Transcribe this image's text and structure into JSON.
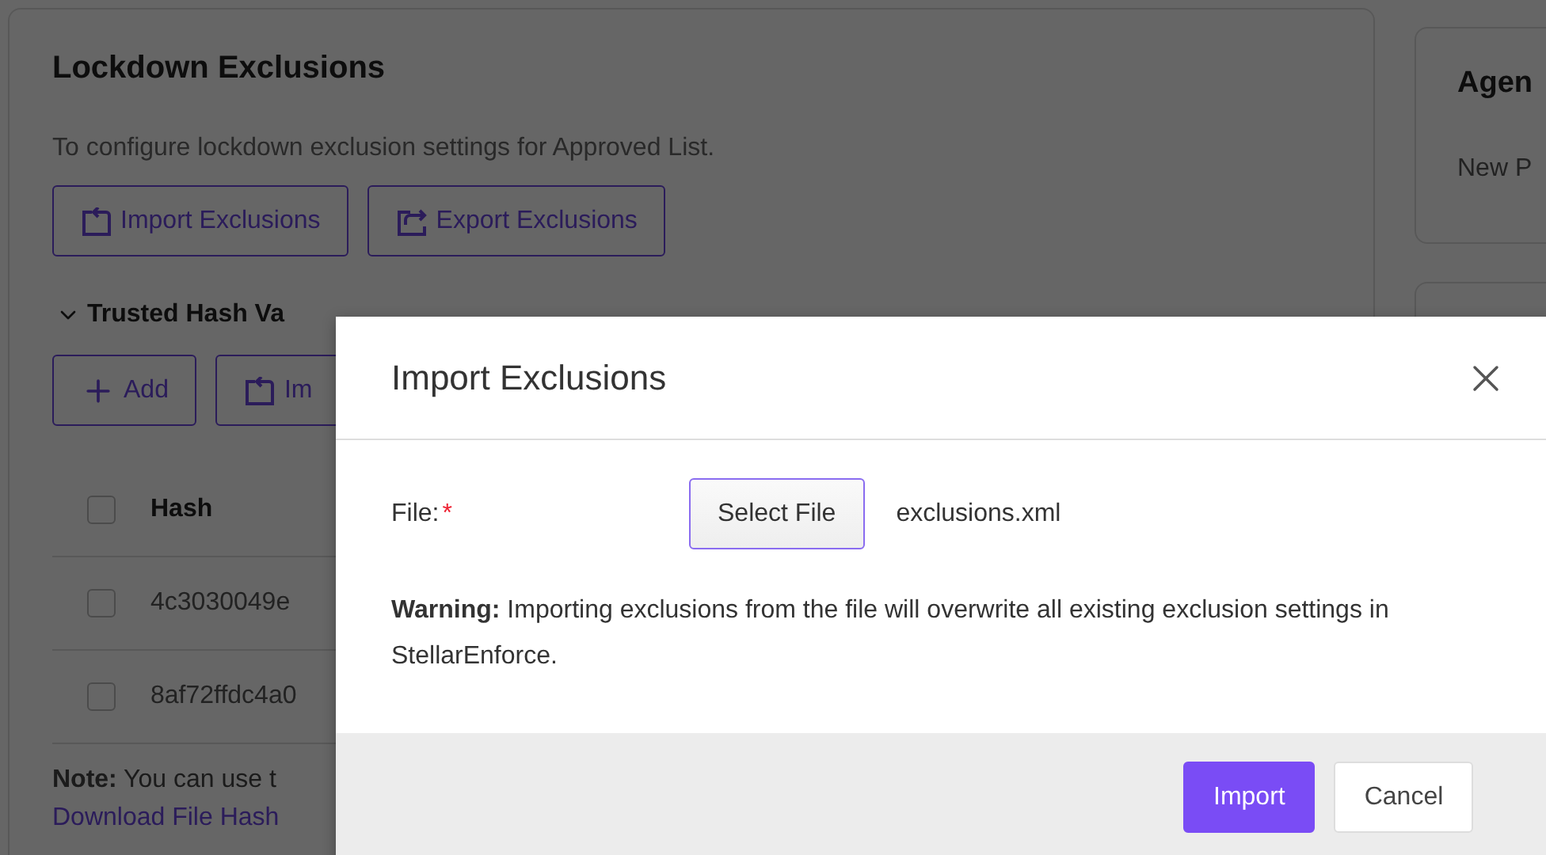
{
  "page": {
    "title": "Lockdown Exclusions",
    "description": "To configure lockdown exclusion settings for Approved List.",
    "buttons": [
      {
        "label": "Import Exclusions",
        "kind": "import"
      },
      {
        "label": "Export Exclusions",
        "kind": "export"
      }
    ],
    "section": {
      "title": "Trusted Hash Va",
      "expanded": true,
      "buttons": [
        {
          "label": "Add",
          "kind": "add"
        },
        {
          "label": "Im",
          "kind": "import"
        }
      ],
      "table": {
        "columns": [
          "Hash"
        ],
        "header_checked": false,
        "rows": [
          {
            "hash": "4c3030049e",
            "checked": false
          },
          {
            "hash": "8af72ffdc4a0",
            "checked": false
          }
        ]
      },
      "note": "**Note:** You can use t",
      "link": "Download File Hash"
    }
  },
  "side_cards": [
    {
      "title": "Agen",
      "text": "New P"
    }
  ],
  "dialog": {
    "title": "Import Exclusions",
    "file_label": "File:",
    "required_mark": "*",
    "select_button": "Select File",
    "file_name": "exclusions.xml",
    "warning": "**Warning:** Importing exclusions from the file will overwrite all existing exclusion settings in StellarEnforce.",
    "buttons": [
      {
        "label": "Import",
        "kind": "primary"
      },
      {
        "label": "Cancel",
        "kind": "secondary"
      }
    ]
  }
}
